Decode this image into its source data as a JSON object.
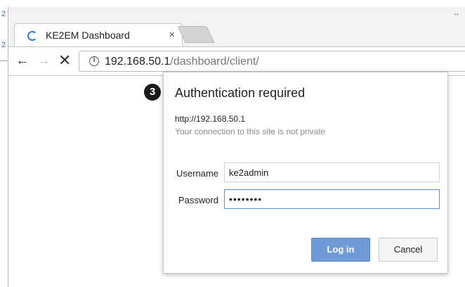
{
  "background": {
    "fragment_1": "2",
    "fragment_2": "2",
    "resize_glyph": "↔"
  },
  "browser": {
    "tab": {
      "title": "KE2EM Dashboard",
      "close": "×",
      "loading_icon": "spinner-icon"
    },
    "toolbar": {
      "back": "←",
      "forward": "→",
      "stop": "✕",
      "info": "i",
      "url_host": "192.168.50.1",
      "url_path": "/dashboard/client/"
    }
  },
  "dialog": {
    "badge": "3",
    "title": "Authentication required",
    "host": "http://192.168.50.1",
    "note": "Your connection to this site is not private",
    "username_label": "Username",
    "username_value": "ke2admin",
    "password_label": "Password",
    "password_value": "••••••••",
    "login_label": "Log in",
    "cancel_label": "Cancel"
  },
  "colors": {
    "accent": "#6e9bd6",
    "focus": "#5a8fd6",
    "spinner": "#2f7fd0"
  }
}
